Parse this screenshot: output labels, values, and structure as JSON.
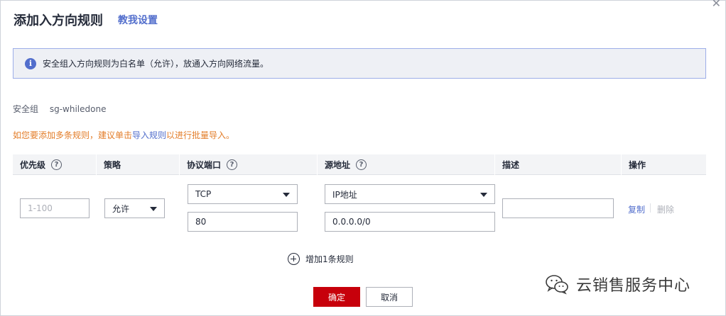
{
  "dialog": {
    "title": "添加入方向规则",
    "help_link": "教我设置",
    "close_icon": "close-icon"
  },
  "notice": {
    "icon": "info-icon",
    "icon_glyph": "i",
    "text": "安全组入方向规则为白名单（允许），放通入方向网络流量。"
  },
  "security_group": {
    "label": "安全组",
    "value": "sg-whiledone"
  },
  "tip": {
    "prefix": "如您要添加多条规则，建议单击",
    "link": "导入规则",
    "suffix": "以进行批量导入。"
  },
  "table": {
    "headers": {
      "priority": "优先级",
      "policy": "策略",
      "protocol_port": "协议端口",
      "source": "源地址",
      "description": "描述",
      "action": "操作"
    },
    "row": {
      "priority_placeholder": "1-100",
      "policy": "允许",
      "protocol": "TCP",
      "port": "80",
      "source_type": "IP地址",
      "source_value": "0.0.0.0/0",
      "description": "",
      "copy_label": "复制",
      "delete_label": "删除"
    }
  },
  "add_rule": {
    "label": "增加1条规则",
    "icon": "plus-circle-icon"
  },
  "buttons": {
    "ok": "确定",
    "cancel": "取消"
  },
  "watermark": {
    "text": "云销售服务中心",
    "icon": "wechat-icon"
  },
  "colors": {
    "primary_red": "#c7000b",
    "link_blue": "#526ecc",
    "warning_orange": "#e37d29",
    "notice_bg": "#eef0f5",
    "notice_border": "#9daee8"
  }
}
